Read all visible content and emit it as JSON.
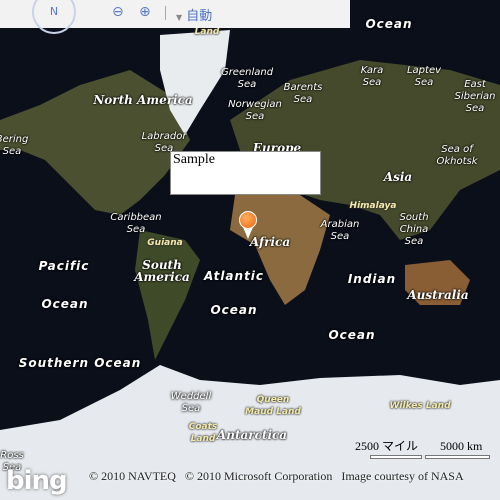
{
  "nav": {
    "compass_label": "N",
    "zoom_out_icon": "zoom-out-icon",
    "zoom_in_icon": "zoom-in-icon",
    "mode_label": "自動",
    "dropdown_icon": "triangle-down-icon"
  },
  "popup": {
    "title": "Sample"
  },
  "pin": {
    "color": "#e8650f"
  },
  "labels": [
    "Ocean",
    "Land",
    "Greenland\nSea",
    "Kara\nSea",
    "Laptev\nSea",
    "East\nSiberian\nSea",
    "North America",
    "Barents\nSea",
    "Norwegian\nSea",
    "Labrador\nSea",
    "Bering\nSea",
    "Europe",
    "Sea of\nOkhotsk",
    "Asia",
    "Himalaya",
    "Caribbean\nSea",
    "Arabian\nSea",
    "South\nChina\nSea",
    "Guiana",
    "Africa",
    "Pacific",
    "South\nAmerica",
    "Atlantic",
    "Indian",
    "Australia",
    "Ocean",
    "Ocean",
    "Ocean",
    "Southern Ocean",
    "Weddell\nSea",
    "Queen\nMaud Land",
    "Wilkes Land",
    "Coats\nLand",
    "Antarctica",
    "Ross\nSea"
  ],
  "scale": {
    "miles": "2500 マイル",
    "km": "5000 km"
  },
  "copyright": "© 2010 NAVTEQ   © 2010 Microsoft Corporation   Image courtesy of NASA",
  "logo": "bing"
}
